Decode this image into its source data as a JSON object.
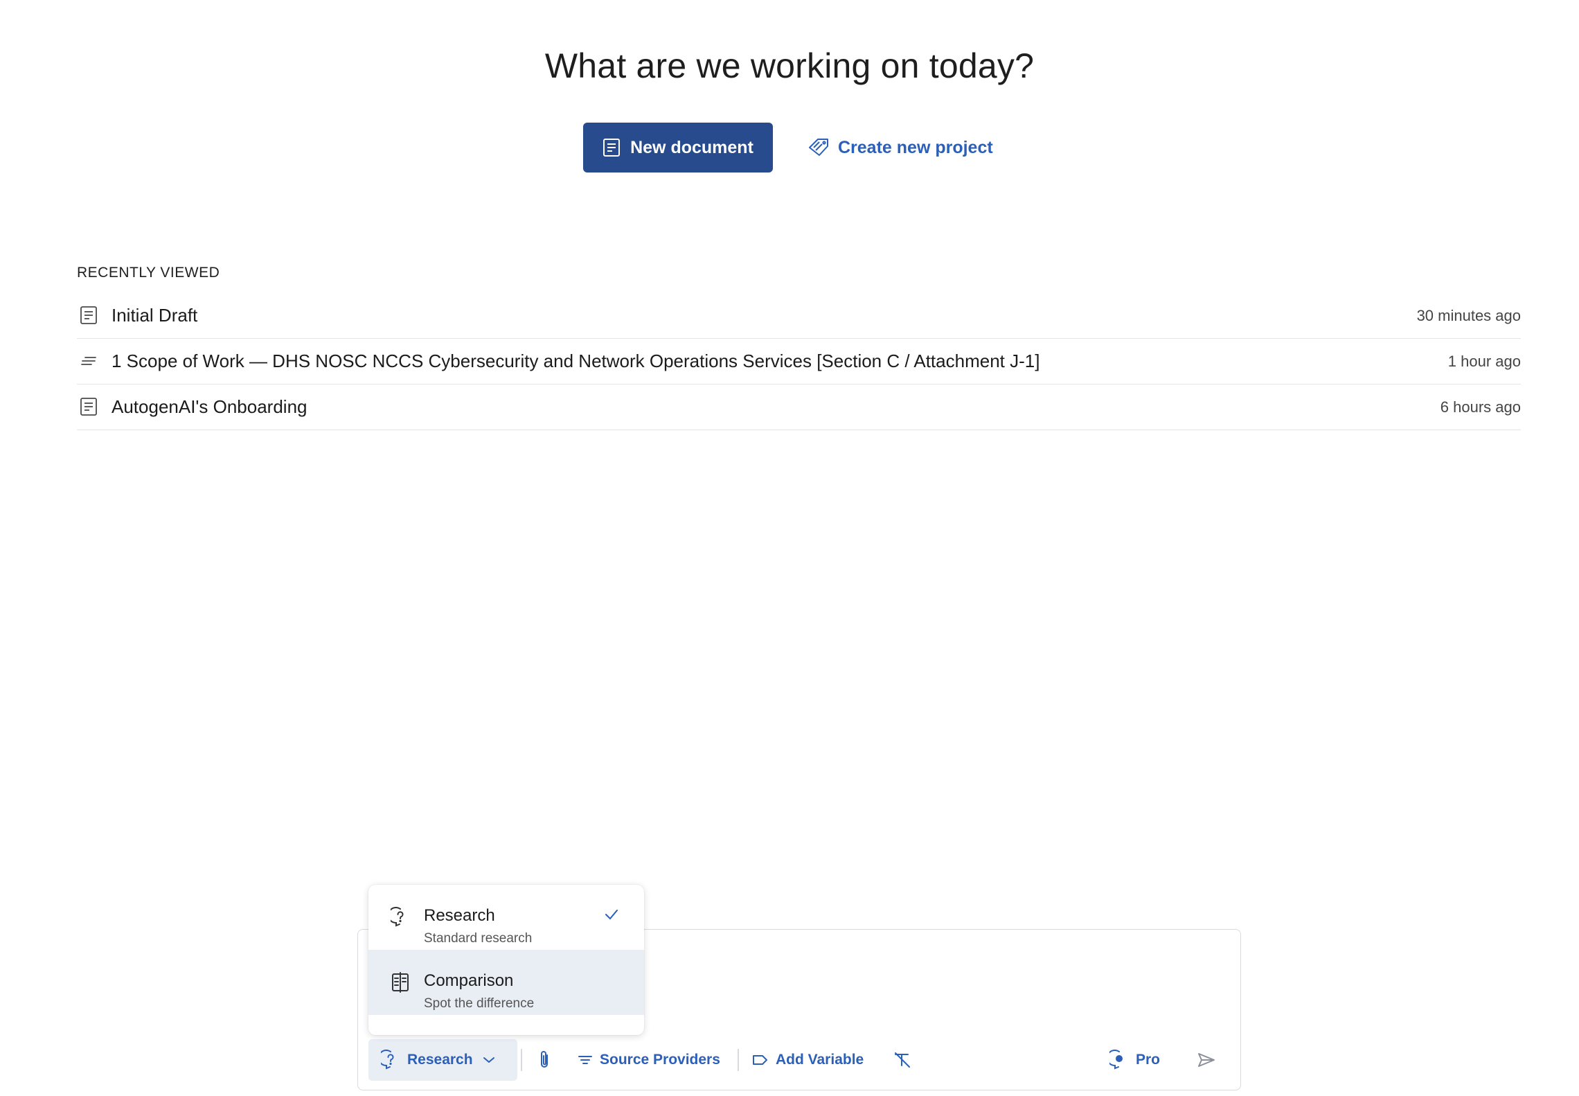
{
  "header": {
    "title": "What are we working on today?",
    "new_document_label": "New document",
    "create_project_label": "Create new project"
  },
  "recent": {
    "heading": "RECENTLY VIEWED",
    "items": [
      {
        "title": "Initial Draft",
        "time": "30 minutes ago",
        "icon": "document-icon"
      },
      {
        "title": "1 Scope of Work — DHS NOSC NCCS Cybersecurity and Network Operations Services [Section C / Attachment J-1]",
        "time": "1 hour ago",
        "icon": "text-lines-icon"
      },
      {
        "title": "AutogenAI's Onboarding",
        "time": "6 hours ago",
        "icon": "document-icon"
      }
    ]
  },
  "menu": {
    "options": [
      {
        "label": "Research",
        "description": "Standard research",
        "selected": true
      },
      {
        "label": "Comparison",
        "description": "Spot the difference",
        "selected": false
      }
    ]
  },
  "toolbar": {
    "mode_label": "Research",
    "source_providers_label": "Source Providers",
    "add_variable_label": "Add Variable",
    "pro_label": "Pro"
  },
  "colors": {
    "primary": "#274b8d",
    "link": "#2b5fb8",
    "hover": "#e9eef5",
    "divider": "#e3e5e8"
  }
}
